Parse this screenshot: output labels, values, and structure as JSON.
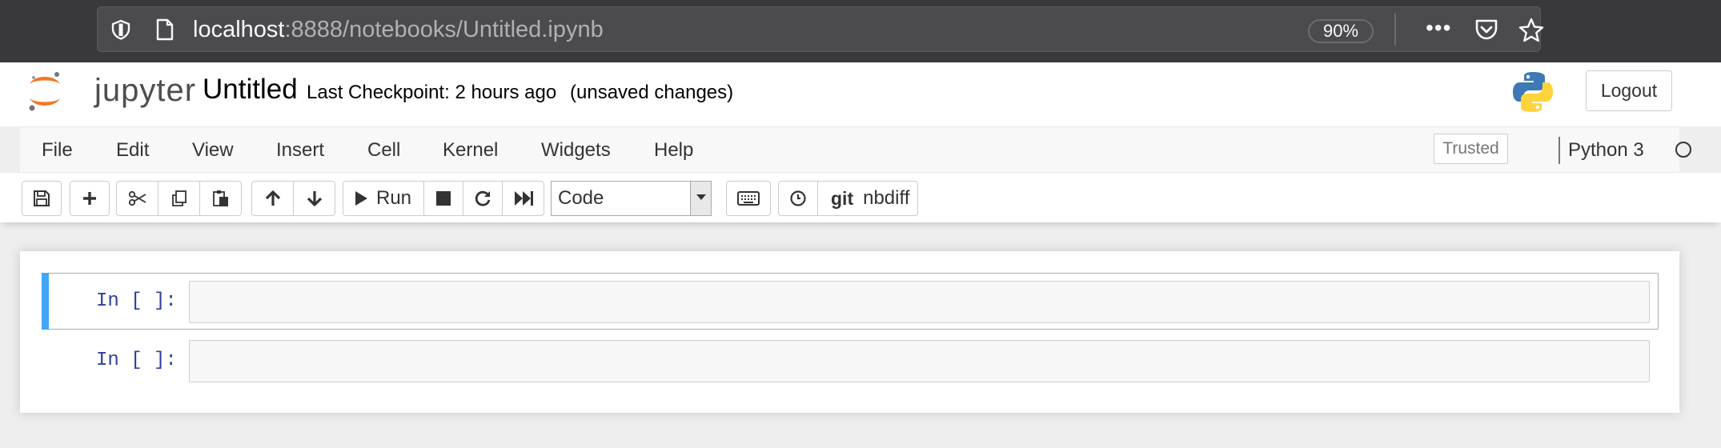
{
  "browser": {
    "url_host": "localhost",
    "url_path": ":8888/notebooks/Untitled.ipynb",
    "zoom": "90%",
    "more_label": "•••"
  },
  "header": {
    "logo_text": "jupyter",
    "notebook_name": "Untitled",
    "checkpoint": "Last Checkpoint: 2 hours ago",
    "autosave_status": "(unsaved changes)",
    "logout_label": "Logout"
  },
  "menubar": {
    "items": [
      "File",
      "Edit",
      "View",
      "Insert",
      "Cell",
      "Kernel",
      "Widgets",
      "Help"
    ],
    "trusted_label": "Trusted",
    "kernel_name": "Python 3"
  },
  "toolbar": {
    "run_label": "Run",
    "cell_type": "Code",
    "nbdiff_git": "git",
    "nbdiff_label": "nbdiff"
  },
  "cells": [
    {
      "prompt": "In [ ]:",
      "source": "",
      "selected": true
    },
    {
      "prompt": "In [ ]:",
      "source": "",
      "selected": false
    }
  ],
  "colors": {
    "chrome_bg": "#38383d",
    "urlbar_bg": "#4a4a4f",
    "jupyter_orange": "#f37726",
    "selected_cell_bar": "#42a5f5",
    "prompt_blue": "#303f9f"
  }
}
